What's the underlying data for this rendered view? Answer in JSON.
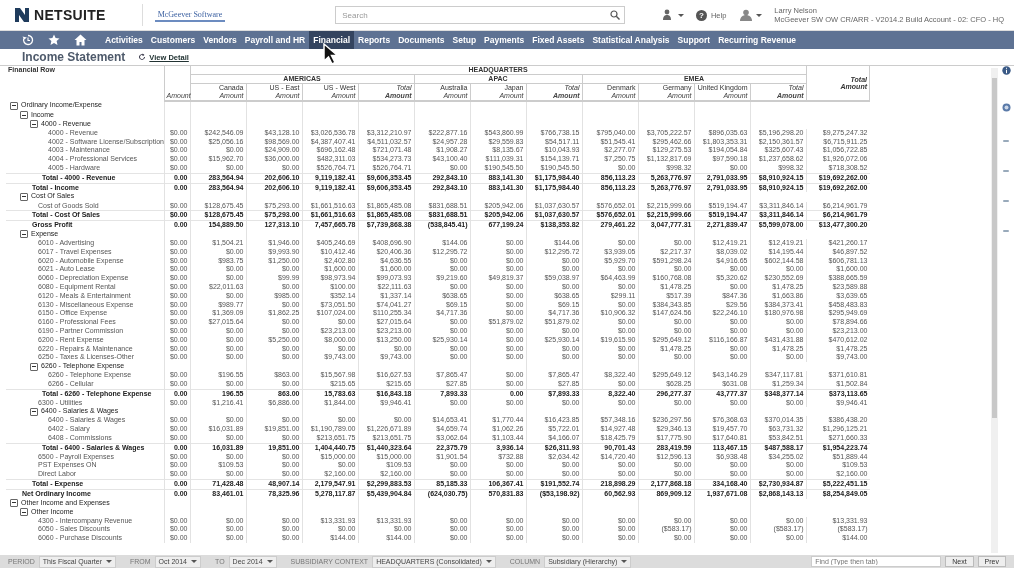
{
  "header": {
    "brand": "NETSUITE",
    "partner_logo": "McGeever Software",
    "search": {
      "placeholder": "Search"
    },
    "help": {
      "icon": "?",
      "label": "Help"
    },
    "user": {
      "name": "Larry Nelson",
      "role": "McGeever SW OW CR/ARR - V2014.2 Build Account - 02: CFO - HQ"
    }
  },
  "nav": [
    {
      "label": "Activities",
      "selected": false
    },
    {
      "label": "Customers",
      "selected": false
    },
    {
      "label": "Vendors",
      "selected": false
    },
    {
      "label": "Payroll and HR",
      "selected": false
    },
    {
      "label": "Financial",
      "selected": true
    },
    {
      "label": "Reports",
      "selected": false
    },
    {
      "label": "Documents",
      "selected": false
    },
    {
      "label": "Setup",
      "selected": false
    },
    {
      "label": "Payments",
      "selected": false
    },
    {
      "label": "Fixed Assets",
      "selected": false
    },
    {
      "label": "Statistical Analysis",
      "selected": false
    },
    {
      "label": "Support",
      "selected": false
    },
    {
      "label": "Recurring Revenue",
      "selected": false
    }
  ],
  "page": {
    "title": "Income Statement",
    "link": "View Detail"
  },
  "table": {
    "corner_label": "Financial Row",
    "first_column": "Amount",
    "group_label": "HEADQUARTERS",
    "regions": [
      {
        "name": "AMERICAS",
        "columns": [
          {
            "name": "Canada",
            "unit": "Amount",
            "kind": "plain"
          },
          {
            "name": "US - East",
            "unit": "Amount",
            "kind": "plain"
          },
          {
            "name": "US - West",
            "unit": "Amount",
            "kind": "plain"
          },
          {
            "name": "Total",
            "unit": "Amount",
            "kind": "total"
          }
        ]
      },
      {
        "name": "APAC",
        "columns": [
          {
            "name": "Australia",
            "unit": "Amount",
            "kind": "plain"
          },
          {
            "name": "Japan",
            "unit": "Amount",
            "kind": "plain"
          },
          {
            "name": "Total",
            "unit": "Amount",
            "kind": "total"
          }
        ]
      },
      {
        "name": "EMEA",
        "columns": [
          {
            "name": "Denmark",
            "unit": "Amount",
            "kind": "plain"
          },
          {
            "name": "Germany",
            "unit": "Amount",
            "kind": "plain"
          },
          {
            "name": "United Kingdom",
            "unit": "Amount",
            "kind": "plain"
          },
          {
            "name": "Total",
            "unit": "Amount",
            "kind": "total"
          }
        ]
      }
    ],
    "grand_total": {
      "name": "Total",
      "unit": "Amount"
    },
    "rows": [
      {
        "kind": "group",
        "label": "Ordinary Income/Expense",
        "expanded": true,
        "children": [
          {
            "kind": "group",
            "label": "Income",
            "expanded": true,
            "children": [
              {
                "kind": "group",
                "label": "4000 - Revenue",
                "expanded": true,
                "children": [
                  {
                    "kind": "line",
                    "label": "4000 - Revenue",
                    "values": [
                      "$0.00",
                      "$242,546.09",
                      "$43,128.10",
                      "$3,026,536.78",
                      "$3,312,210.97",
                      "$222,877.16",
                      "$543,860.99",
                      "$766,738.15",
                      "$795,040.00",
                      "$3,705,222.57",
                      "$896,035.63",
                      "$5,196,298.20",
                      "$9,275,247.32"
                    ]
                  },
                  {
                    "kind": "line",
                    "label": "4002 - Software License/Subscription",
                    "values": [
                      "$0.00",
                      "$25,056.16",
                      "$98,569.00",
                      "$4,387,407.41",
                      "$4,511,032.57",
                      "$24,957.28",
                      "$29,559.83",
                      "$54,517.11",
                      "$51,545.41",
                      "$295,462.66",
                      "$1,803,353.31",
                      "$2,150,361.57",
                      "$6,715,911.25"
                    ]
                  },
                  {
                    "kind": "line",
                    "label": "4003 - Maintenance",
                    "values": [
                      "$0.00",
                      "$0.00",
                      "$24,909.00",
                      "$696,162.48",
                      "$721,071.48",
                      "$1,908.27",
                      "$8,135.67",
                      "$10,043.93",
                      "$2,277.07",
                      "$129,275.53",
                      "$194,054.84",
                      "$325,607.43",
                      "$1,056,722.85"
                    ]
                  },
                  {
                    "kind": "line",
                    "label": "4004 - Professional Services",
                    "values": [
                      "$0.00",
                      "$15,962.70",
                      "$36,000.00",
                      "$482,311.03",
                      "$534,273.73",
                      "$43,100.40",
                      "$111,039.31",
                      "$154,139.71",
                      "$7,250.75",
                      "$1,132,817.69",
                      "$97,590.18",
                      "$1,237,658.62",
                      "$1,926,072.06"
                    ]
                  },
                  {
                    "kind": "line",
                    "label": "4005 - Hardware",
                    "values": [
                      "$0.00",
                      "$0.00",
                      "$0.00",
                      "$526,764.71",
                      "$526,764.71",
                      "$0.00",
                      "$190,545.50",
                      "$190,545.50",
                      "$0.00",
                      "$998.32",
                      "$0.00",
                      "$998.32",
                      "$718,308.52"
                    ]
                  }
                ]
              },
              {
                "kind": "total",
                "label": "Total - 4000 - Revenue",
                "values": [
                  "0.00",
                  "283,564.94",
                  "202,606.10",
                  "9,119,182.41",
                  "$9,606,353.45",
                  "292,843.10",
                  "883,141.30",
                  "$1,175,984.40",
                  "856,113.23",
                  "5,263,776.97",
                  "2,791,033.95",
                  "$8,910,924.15",
                  "$19,692,262.00"
                ]
              }
            ]
          },
          {
            "kind": "total",
            "label": "Total - Income",
            "values": [
              "0.00",
              "283,564.94",
              "202,606.10",
              "9,119,182.41",
              "$9,606,353.45",
              "292,843.10",
              "883,141.30",
              "$1,175,984.40",
              "856,113.23",
              "5,263,776.97",
              "2,791,033.95",
              "$8,910,924.15",
              "$19,692,262.00"
            ]
          },
          {
            "kind": "group",
            "label": "Cost Of Sales",
            "expanded": true,
            "children": [
              {
                "kind": "line",
                "label": "Cost of Goods Sold",
                "values": [
                  "$0.00",
                  "$128,675.45",
                  "$75,293.00",
                  "$1,661,516.63",
                  "$1,865,485.08",
                  "$831,688.51",
                  "$205,942.06",
                  "$1,037,630.57",
                  "$576,652.01",
                  "$2,215,999.66",
                  "$519,194.47",
                  "$3,311,846.14",
                  "$6,214,961.79"
                ]
              }
            ]
          },
          {
            "kind": "total",
            "label": "Total - Cost Of Sales",
            "values": [
              "$0.00",
              "$128,675.45",
              "$75,293.00",
              "$1,661,516.63",
              "$1,865,485.08",
              "$831,688.51",
              "$205,942.06",
              "$1,037,630.57",
              "$576,652.01",
              "$2,215,999.66",
              "$519,194.47",
              "$3,311,846.14",
              "$6,214,961.79"
            ]
          },
          {
            "kind": "total",
            "label": "Gross Profit",
            "values": [
              "0.00",
              "154,889.50",
              "127,313.10",
              "7,457,665.78",
              "$7,739,868.38",
              "(538,845.41)",
              "677,199.24",
              "$138,353.82",
              "279,461.22",
              "3,047,777.31",
              "2,271,839.47",
              "$5,599,078.00",
              "$13,477,300.20"
            ]
          },
          {
            "kind": "group",
            "label": "Expense",
            "expanded": true,
            "children": [
              {
                "kind": "line",
                "label": "6010 - Advertising",
                "values": [
                  "$0.00",
                  "$1,504.21",
                  "$1,946.00",
                  "$405,246.69",
                  "$408,696.90",
                  "$144.06",
                  "$0.00",
                  "$144.06",
                  "$0.00",
                  "$0.00",
                  "$12,419.21",
                  "$12,419.21",
                  "$421,260.17"
                ]
              },
              {
                "kind": "line",
                "label": "6017 - Travel Expenses",
                "values": [
                  "$0.00",
                  "$0.00",
                  "$9,993.90",
                  "$10,412.46",
                  "$20,406.36",
                  "$12,295.72",
                  "$0.00",
                  "$12,295.72",
                  "$3,939.05",
                  "$2,217.37",
                  "$8,039.02",
                  "$14,195.44",
                  "$46,897.52"
                ]
              },
              {
                "kind": "line",
                "label": "6020 - Automobile Expense",
                "values": [
                  "$0.00",
                  "$983.75",
                  "$1,250.00",
                  "$2,402.80",
                  "$4,636.55",
                  "$0.00",
                  "$0.00",
                  "$0.00",
                  "$5,929.70",
                  "$591,298.24",
                  "$4,916.65",
                  "$602,144.58",
                  "$606,781.13"
                ]
              },
              {
                "kind": "line",
                "label": "6021 - Auto Lease",
                "values": [
                  "$0.00",
                  "$0.00",
                  "$0.00",
                  "$1,600.00",
                  "$1,600.00",
                  "$0.00",
                  "$0.00",
                  "$0.00",
                  "$0.00",
                  "$0.00",
                  "$0.00",
                  "$0.00",
                  "$1,600.00"
                ]
              },
              {
                "kind": "line",
                "label": "6060 - Depreciation Expense",
                "values": [
                  "$0.00",
                  "$0.00",
                  "$99.99",
                  "$98,973.94",
                  "$99,073.93",
                  "$9,219.60",
                  "$49,819.37",
                  "$59,038.97",
                  "$64,463.99",
                  "$160,768.08",
                  "$5,320.62",
                  "$230,552.69",
                  "$388,665.59"
                ]
              },
              {
                "kind": "line",
                "label": "6080 - Equipment Rental",
                "values": [
                  "$0.00",
                  "$22,011.63",
                  "$0.00",
                  "$100.00",
                  "$22,111.63",
                  "$0.00",
                  "$0.00",
                  "$0.00",
                  "$0.00",
                  "$1,478.25",
                  "$0.00",
                  "$1,478.25",
                  "$23,589.88"
                ]
              },
              {
                "kind": "line",
                "label": "6120 - Meals & Entertainment",
                "values": [
                  "$0.00",
                  "$0.00",
                  "$985.00",
                  "$352.14",
                  "$1,337.14",
                  "$638.65",
                  "$0.00",
                  "$638.65",
                  "$299.11",
                  "$517.39",
                  "$847.36",
                  "$1,663.86",
                  "$3,639.65"
                ]
              },
              {
                "kind": "line",
                "label": "6130 - Miscellaneous Expense",
                "values": [
                  "$0.00",
                  "$989.77",
                  "$0.00",
                  "$73,051.50",
                  "$74,041.27",
                  "$69.15",
                  "$0.00",
                  "$69.15",
                  "$0.00",
                  "$384,343.85",
                  "$29.56",
                  "$384,373.41",
                  "$458,483.83"
                ]
              },
              {
                "kind": "line",
                "label": "6150 - Office Expense",
                "values": [
                  "$0.00",
                  "$1,369.09",
                  "$1,862.25",
                  "$107,024.00",
                  "$110,255.34",
                  "$4,717.36",
                  "$0.00",
                  "$4,717.36",
                  "$10,906.32",
                  "$147,624.56",
                  "$22,246.10",
                  "$180,976.98",
                  "$295,949.69"
                ]
              },
              {
                "kind": "line",
                "label": "6160 - Professional Fees",
                "values": [
                  "$0.00",
                  "$27,015.64",
                  "$0.00",
                  "$0.00",
                  "$27,015.64",
                  "$0.00",
                  "$51,879.02",
                  "$51,879.02",
                  "$0.00",
                  "$0.00",
                  "$0.00",
                  "$0.00",
                  "$78,894.66"
                ]
              },
              {
                "kind": "line",
                "label": "6190 - Partner Commission",
                "values": [
                  "$0.00",
                  "$0.00",
                  "$0.00",
                  "$23,213.00",
                  "$23,213.00",
                  "$0.00",
                  "$0.00",
                  "$0.00",
                  "$0.00",
                  "$0.00",
                  "$0.00",
                  "$0.00",
                  "$23,213.00"
                ]
              },
              {
                "kind": "line",
                "label": "6200 - Rent Expense",
                "values": [
                  "$0.00",
                  "$0.00",
                  "$5,250.00",
                  "$8,000.00",
                  "$13,250.00",
                  "$25,930.14",
                  "$0.00",
                  "$25,930.14",
                  "$19,615.90",
                  "$295,649.12",
                  "$116,166.87",
                  "$431,431.88",
                  "$470,612.02"
                ]
              },
              {
                "kind": "line",
                "label": "6220 - Repairs & Maintenance",
                "values": [
                  "$0.00",
                  "$0.00",
                  "$0.00",
                  "$0.00",
                  "$0.00",
                  "$0.00",
                  "$0.00",
                  "$0.00",
                  "$0.00",
                  "$1,478.25",
                  "$0.00",
                  "$1,478.25",
                  "$1,478.25"
                ]
              },
              {
                "kind": "line",
                "label": "6250 - Taxes & Licenses-Other",
                "values": [
                  "$0.00",
                  "$0.00",
                  "$0.00",
                  "$9,743.00",
                  "$9,743.00",
                  "$0.00",
                  "$0.00",
                  "$0.00",
                  "$0.00",
                  "$0.00",
                  "$0.00",
                  "$0.00",
                  "$9,743.00"
                ]
              },
              {
                "kind": "group",
                "label": "6260 - Telephone Expense",
                "expanded": true,
                "children": [
                  {
                    "kind": "line",
                    "label": "6260 - Telephone Expense",
                    "values": [
                      "$0.00",
                      "$196.55",
                      "$863.00",
                      "$15,567.98",
                      "$16,627.53",
                      "$7,865.47",
                      "$0.00",
                      "$7,865.47",
                      "$8,322.40",
                      "$295,649.12",
                      "$43,146.29",
                      "$347,117.81",
                      "$371,610.81"
                    ]
                  },
                  {
                    "kind": "line",
                    "label": "6266 - Cellular",
                    "values": [
                      "$0.00",
                      "$0.00",
                      "$0.00",
                      "$215.65",
                      "$215.65",
                      "$27.85",
                      "$0.00",
                      "$27.85",
                      "$0.00",
                      "$628.25",
                      "$631.08",
                      "$1,259.34",
                      "$1,502.84"
                    ]
                  }
                ]
              },
              {
                "kind": "total",
                "label": "Total - 6260 - Telephone Expense",
                "values": [
                  "0.00",
                  "196.55",
                  "863.00",
                  "15,783.63",
                  "$16,843.18",
                  "7,893.33",
                  "0.00",
                  "$7,893.33",
                  "8,322.40",
                  "296,277.37",
                  "43,777.37",
                  "$348,377.14",
                  "$373,113.65"
                ]
              },
              {
                "kind": "line",
                "label": "6300 - Utilities",
                "values": [
                  "$0.00",
                  "$1,216.41",
                  "$6,886.00",
                  "$1,844.00",
                  "$9,946.41",
                  "$0.00",
                  "$0.00",
                  "$0.00",
                  "$0.00",
                  "$0.00",
                  "$0.00",
                  "$0.00",
                  "$9,946.41"
                ]
              },
              {
                "kind": "group",
                "label": "6400 - Salaries & Wages",
                "expanded": true,
                "children": [
                  {
                    "kind": "line",
                    "label": "6400 - Salaries & Wages",
                    "values": [
                      "$0.00",
                      "$0.00",
                      "$0.00",
                      "$0.00",
                      "$0.00",
                      "$14,653.41",
                      "$1,770.44",
                      "$16,423.85",
                      "$57,348.16",
                      "$236,297.56",
                      "$76,368.63",
                      "$370,014.35",
                      "$386,438.20"
                    ]
                  },
                  {
                    "kind": "line",
                    "label": "6402 - Salary",
                    "values": [
                      "$0.00",
                      "$16,031.89",
                      "$19,851.00",
                      "$1,190,789.00",
                      "$1,226,671.89",
                      "$4,659.74",
                      "$1,062.26",
                      "$5,722.01",
                      "$14,927.48",
                      "$29,346.13",
                      "$19,457.70",
                      "$63,731.32",
                      "$1,296,125.21"
                    ]
                  },
                  {
                    "kind": "line",
                    "label": "6408 - Commissions",
                    "values": [
                      "$0.00",
                      "$0.00",
                      "$0.00",
                      "$213,651.75",
                      "$213,651.75",
                      "$3,062.64",
                      "$1,103.44",
                      "$4,166.07",
                      "$18,425.79",
                      "$17,775.90",
                      "$17,640.81",
                      "$53,842.51",
                      "$271,660.33"
                    ]
                  }
                ]
              },
              {
                "kind": "total",
                "label": "Total - 6400 - Salaries & Wages",
                "values": [
                  "0.00",
                  "16,031.89",
                  "19,851.00",
                  "1,404,440.75",
                  "$1,440,323.64",
                  "22,375.79",
                  "3,936.14",
                  "$26,311.93",
                  "90,701.43",
                  "283,419.59",
                  "113,467.15",
                  "$487,588.17",
                  "$1,954,223.74"
                ]
              },
              {
                "kind": "line",
                "label": "6500 - Payroll Expenses",
                "values": [
                  "$0.00",
                  "$0.00",
                  "$0.00",
                  "$15,000.00",
                  "$15,000.00",
                  "$1,901.54",
                  "$732.88",
                  "$2,634.42",
                  "$14,720.40",
                  "$12,596.13",
                  "$6,938.48",
                  "$34,255.02",
                  "$51,889.44"
                ]
              },
              {
                "kind": "line",
                "label": "PST Expenses ON",
                "values": [
                  "$0.00",
                  "$109.53",
                  "$0.00",
                  "$0.00",
                  "$109.53",
                  "$0.00",
                  "$0.00",
                  "$0.00",
                  "$0.00",
                  "$0.00",
                  "$0.00",
                  "$0.00",
                  "$109.53"
                ]
              },
              {
                "kind": "line",
                "label": "Direct Labor",
                "values": [
                  "$0.00",
                  "$0.00",
                  "$0.00",
                  "$2,160.00",
                  "$2,160.00",
                  "$0.00",
                  "$0.00",
                  "$0.00",
                  "$0.00",
                  "$0.00",
                  "$0.00",
                  "$0.00",
                  "$2,160.00"
                ]
              }
            ]
          },
          {
            "kind": "total",
            "label": "Total - Expense",
            "values": [
              "0.00",
              "71,428.48",
              "48,907.14",
              "2,179,547.91",
              "$2,299,883.53",
              "85,185.33",
              "106,367.41",
              "$191,552.74",
              "218,898.29",
              "2,177,868.18",
              "334,168.40",
              "$2,730,934.87",
              "$5,222,451.15"
            ]
          }
        ]
      },
      {
        "kind": "total",
        "label": "Net Ordinary Income",
        "values": [
          "0.00",
          "83,461.01",
          "78,325.96",
          "5,278,117.87",
          "$5,439,904.84",
          "(624,030.75)",
          "570,831.83",
          "($53,198.92)",
          "60,562.93",
          "869,909.12",
          "1,937,671.08",
          "$2,868,143.13",
          "$8,254,849.05"
        ]
      },
      {
        "kind": "group",
        "label": "Other Income and Expenses",
        "expanded": true,
        "children": [
          {
            "kind": "group",
            "label": "Other Income",
            "expanded": true,
            "children": [
              {
                "kind": "line",
                "label": "4300 - Intercompany Revenue",
                "values": [
                  "$0.00",
                  "$0.00",
                  "$0.00",
                  "$13,331.93",
                  "$13,331.93",
                  "$0.00",
                  "$0.00",
                  "$0.00",
                  "$0.00",
                  "$0.00",
                  "$0.00",
                  "$0.00",
                  "$13,331.93"
                ]
              },
              {
                "kind": "line",
                "label": "6050 - Sales Discounts",
                "values": [
                  "$0.00",
                  "$0.00",
                  "$0.00",
                  "$0.00",
                  "$0.00",
                  "$0.00",
                  "$0.00",
                  "$0.00",
                  "$0.00",
                  "($583.17)",
                  "$0.00",
                  "($583.17)",
                  "($583.17)"
                ]
              },
              {
                "kind": "line",
                "label": "6060 - Purchase Discounts",
                "values": [
                  "$0.00",
                  "$0.00",
                  "$0.00",
                  "$144.00",
                  "$144.00",
                  "$0.00",
                  "$0.00",
                  "$0.00",
                  "$0.00",
                  "$0.00",
                  "$0.00",
                  "$0.00",
                  "$144.00"
                ]
              }
            ]
          }
        ]
      }
    ]
  },
  "filters": [
    {
      "label": "PERIOD",
      "value": "This Fiscal Quarter"
    },
    {
      "label": "FROM",
      "value": "Oct 2014"
    },
    {
      "label": "TO",
      "value": "Dec 2014"
    },
    {
      "label": "SUBSIDIARY CONTEXT",
      "value": "HEADQUARTERS (Consolidated)"
    },
    {
      "label": "COLUMN",
      "value": "Subsidiary (Hierarchy)"
    }
  ],
  "find": {
    "placeholder": "Find (Type then tab)"
  },
  "buttons": [
    "Next",
    "Prev"
  ]
}
